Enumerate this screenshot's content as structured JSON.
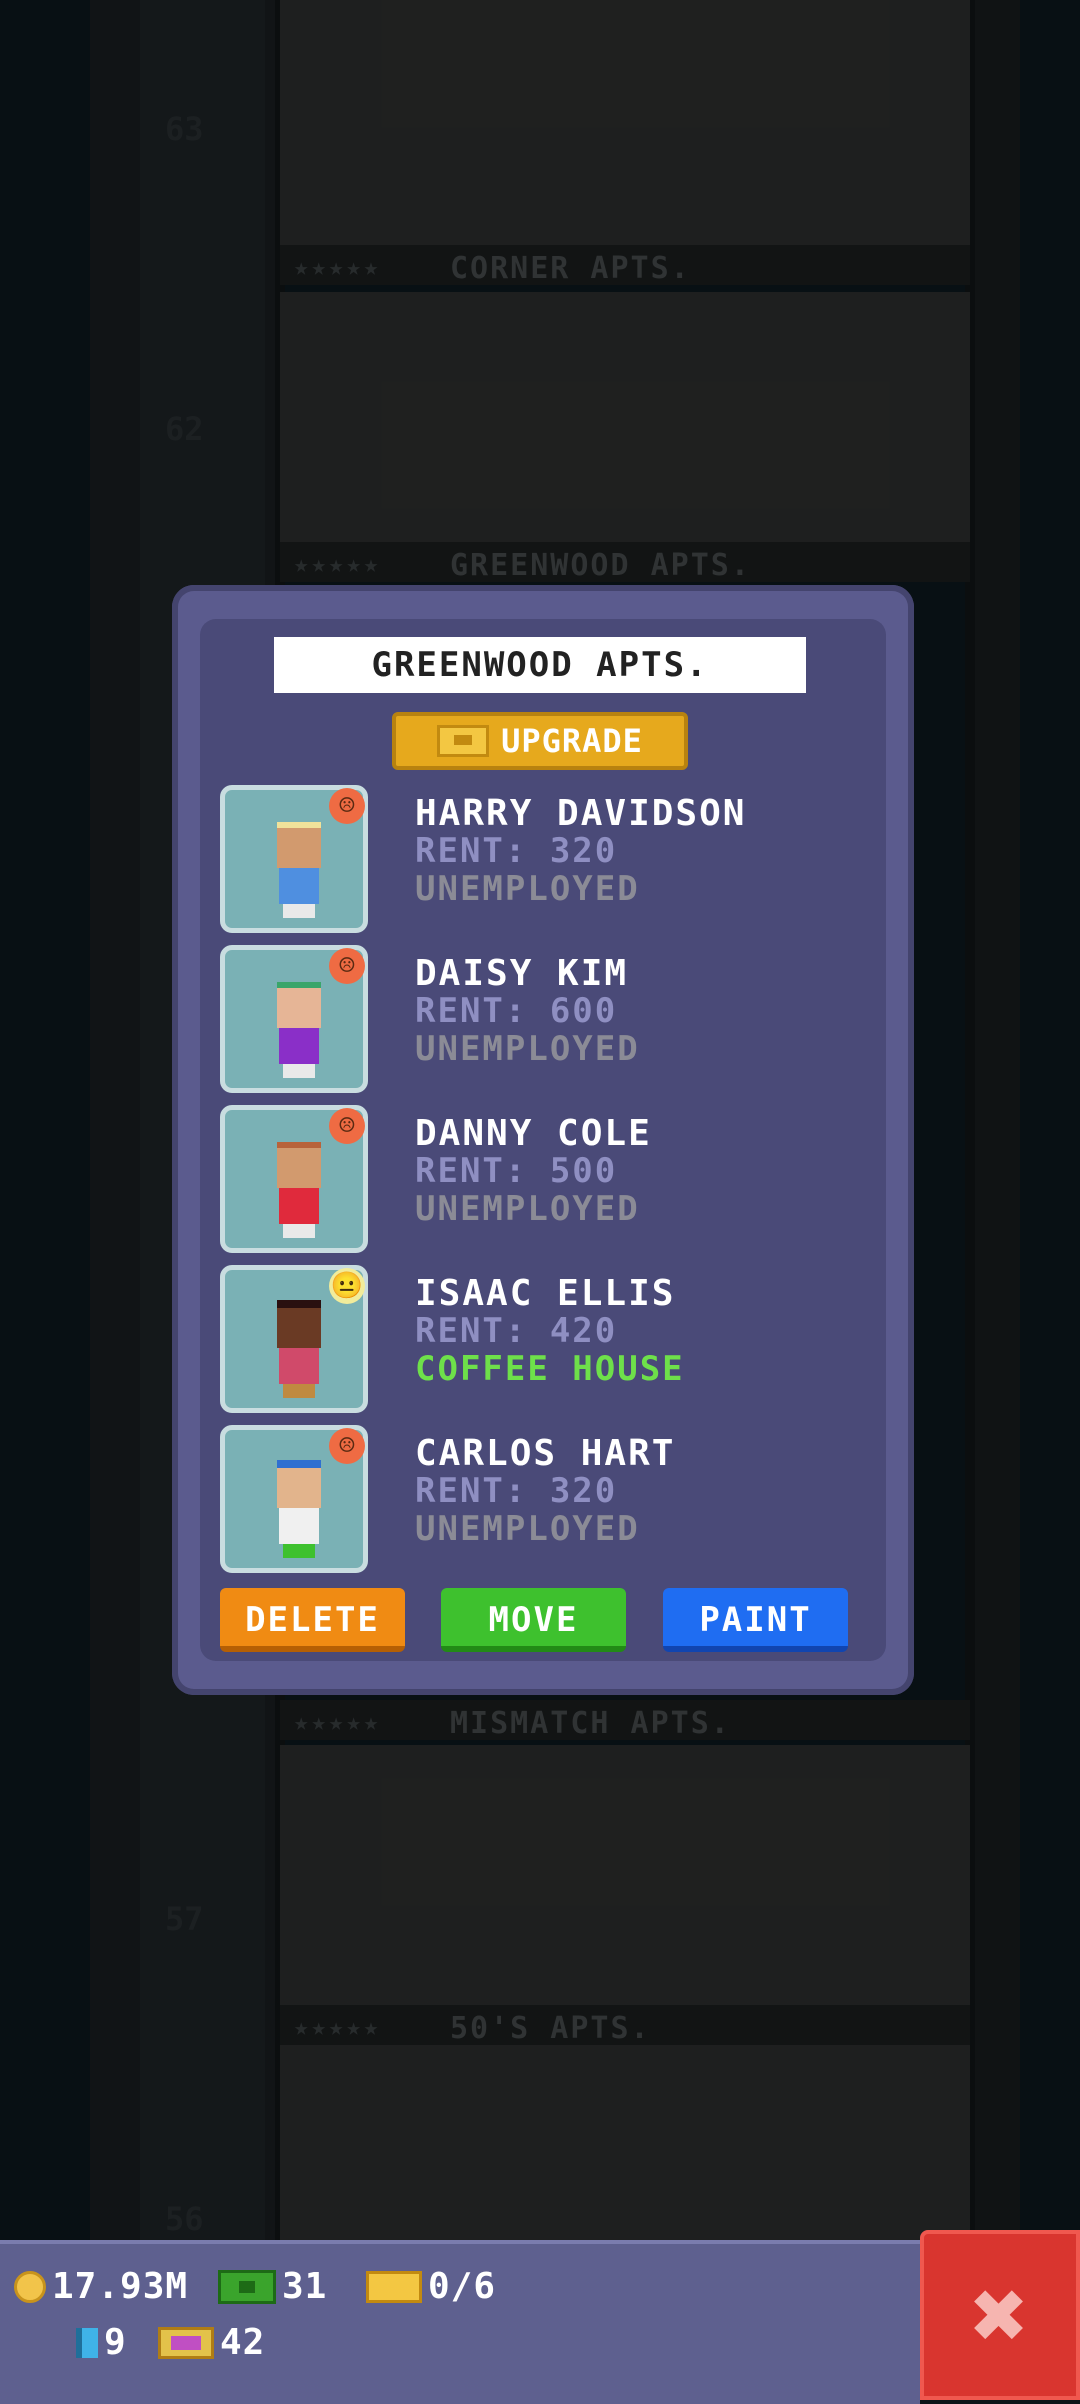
{
  "background": {
    "floors": [
      {
        "label": "CORNER APTS.",
        "number": "63",
        "stars": "★★★★★"
      },
      {
        "label": "GREENWOOD APTS.",
        "number": "62",
        "stars": "★★★★★"
      },
      {
        "label": "MISMATCH APTS.",
        "number": "",
        "stars": "★★★★★"
      },
      {
        "label": "50'S APTS.",
        "number": "57",
        "stars": "★★★★★"
      },
      {
        "label": "",
        "number": "56",
        "stars": ""
      }
    ]
  },
  "dialog": {
    "title": "GREENWOOD APTS.",
    "upgrade_label": "UPGRADE",
    "residents": [
      {
        "name": "HARRY DAVIDSON",
        "rent": "RENT: 320",
        "job": "UNEMPLOYED",
        "mood": "sad",
        "mood_icon": "☹"
      },
      {
        "name": "DAISY KIM",
        "rent": "RENT: 600",
        "job": "UNEMPLOYED",
        "mood": "sad",
        "mood_icon": "☹"
      },
      {
        "name": "DANNY COLE",
        "rent": "RENT: 500",
        "job": "UNEMPLOYED",
        "mood": "sad",
        "mood_icon": "☹"
      },
      {
        "name": "ISAAC ELLIS",
        "rent": "RENT: 420",
        "job": "COFFEE HOUSE",
        "mood": "neutral",
        "mood_icon": "😐"
      },
      {
        "name": "CARLOS HART",
        "rent": "RENT: 320",
        "job": "UNEMPLOYED",
        "mood": "sad",
        "mood_icon": "☹"
      }
    ],
    "buttons": {
      "delete": "DELETE",
      "move": "MOVE",
      "paint": "PAINT"
    }
  },
  "hud": {
    "coins": "17.93M",
    "bux": "31",
    "tickets": "0/6",
    "tools": "9",
    "vip": "42",
    "close_icon": "✖"
  }
}
